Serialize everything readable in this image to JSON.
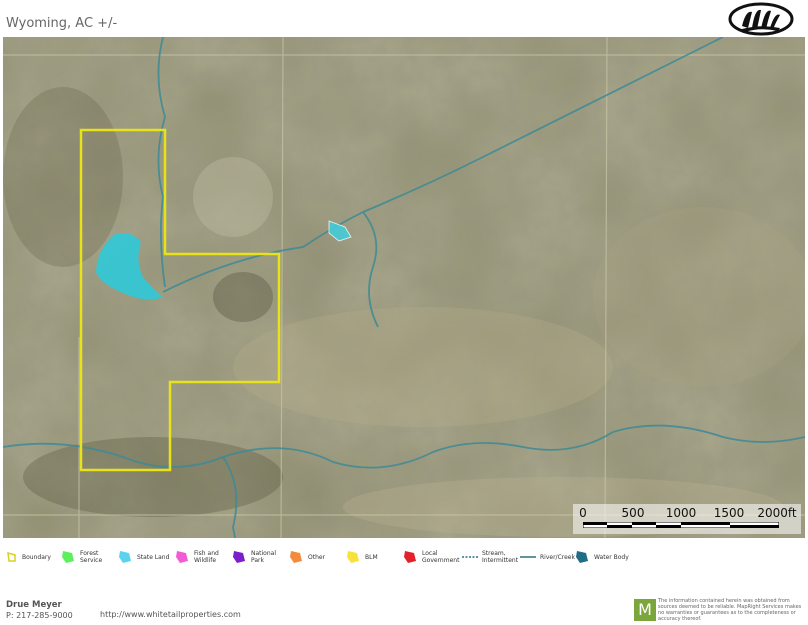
{
  "header": {
    "title": "Wyoming,  AC +/-",
    "logo_icon": "bear-paw-logo-icon"
  },
  "map": {
    "type": "satellite-imagery",
    "boundary_color": "#e8e21a",
    "water_body_color": "#2fc9d8",
    "scale_bar": {
      "labels": [
        "0",
        "500",
        "1000",
        "1500",
        "2000ft"
      ]
    }
  },
  "legend": {
    "items": [
      {
        "label": "Boundary",
        "icon": "boundary-icon",
        "color": "#e8e21a"
      },
      {
        "label": "Forest Service",
        "icon": "forest-service-icon",
        "color": "#5cf05c"
      },
      {
        "label": "State Land",
        "icon": "state-land-icon",
        "color": "#5bd3f0"
      },
      {
        "label": "Fish and Wildlife",
        "icon": "fish-wildlife-icon",
        "color": "#f25bd6"
      },
      {
        "label": "National Park",
        "icon": "national-park-icon",
        "color": "#7a1fc9"
      },
      {
        "label": "Other",
        "icon": "other-icon",
        "color": "#f58a3c"
      },
      {
        "label": "BLM",
        "icon": "blm-icon",
        "color": "#f7e23a"
      },
      {
        "label": "Local Government",
        "icon": "local-government-icon",
        "color": "#e0222a"
      },
      {
        "label": "Stream, Intermittent",
        "icon": "stream-intermittent-icon",
        "color": "#2a6f86"
      },
      {
        "label": "River/Creek",
        "icon": "river-creek-icon",
        "color": "#2a6f86"
      },
      {
        "label": "Water Body",
        "icon": "water-body-icon",
        "color": "#1f6d86"
      }
    ]
  },
  "footer": {
    "agent_name": "Drue Meyer",
    "phone": "P: 217-285-9000",
    "url": "http://www.whitetailproperties.com",
    "mapright_logo_letter": "M",
    "disclaimer": "The information contained herein was obtained from sources deemed to be reliable. MapRight Services makes no warranties or guarantees as to the completeness or accuracy thereof."
  }
}
